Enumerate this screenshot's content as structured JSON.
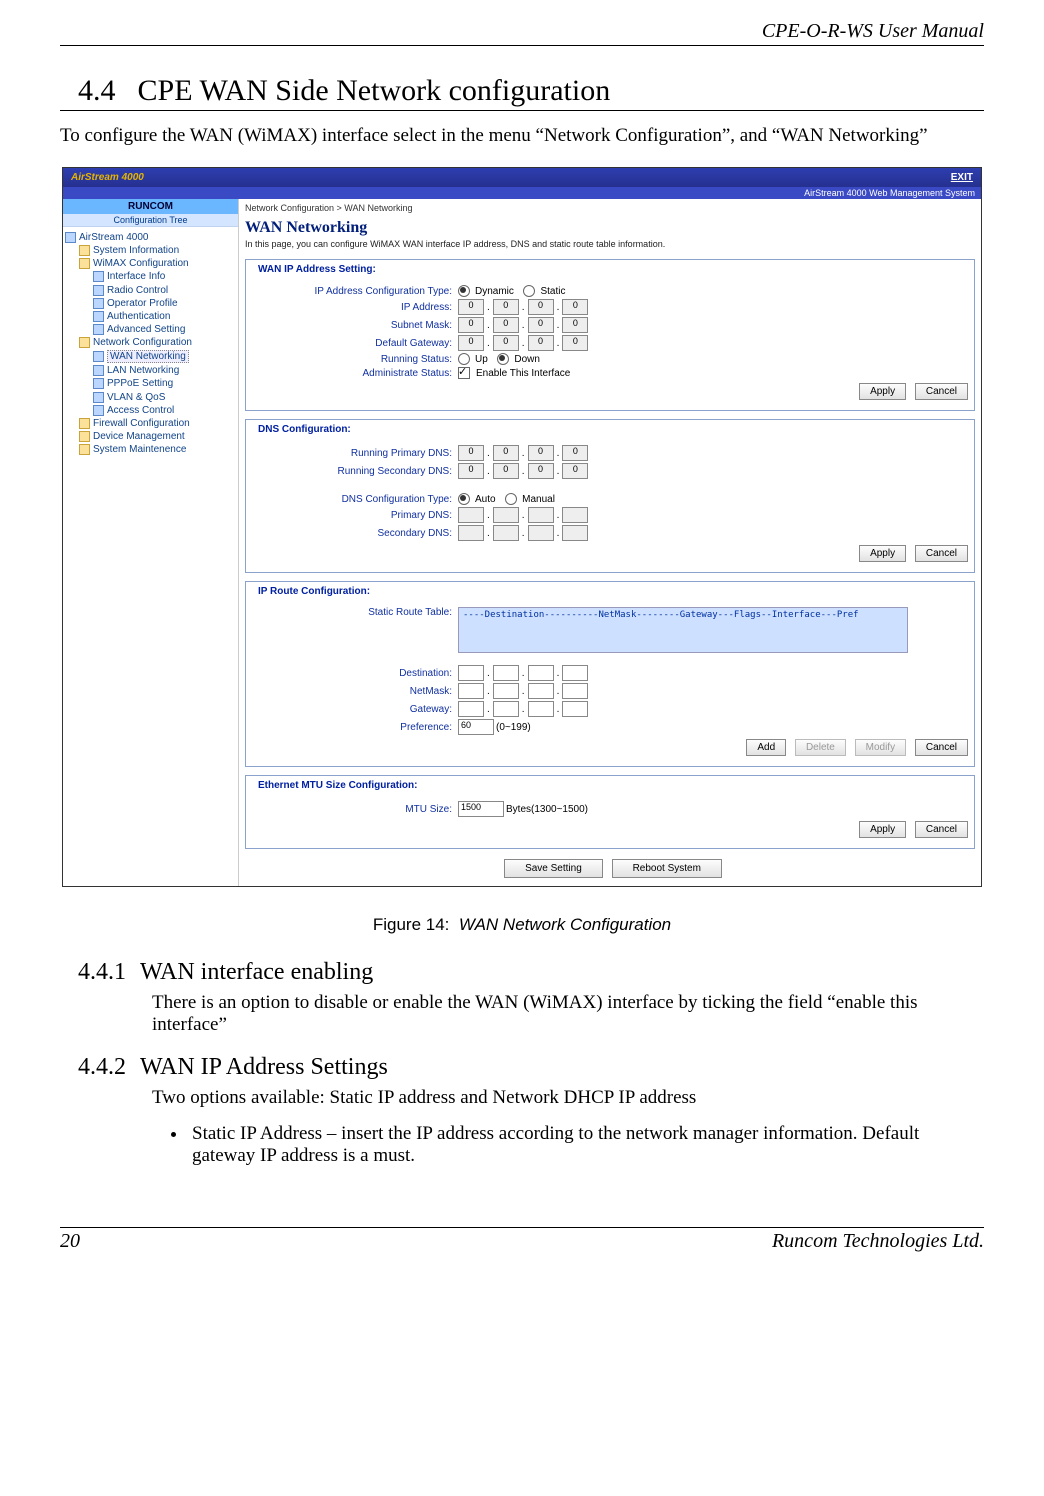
{
  "doc": {
    "header": "CPE-O-R-WS User Manual",
    "section_num": "4.4",
    "section_title": "CPE WAN Side Network configuration",
    "intro": "To configure the WAN (WiMAX) interface select in the menu “Network Configuration”, and “WAN Networking”",
    "figure_label": "Figure 14:",
    "figure_caption": "WAN Network Configuration",
    "sub1_num": "4.4.1",
    "sub1_title": "WAN interface enabling",
    "sub1_body": "There is an option to disable or enable the WAN (WiMAX) interface by ticking the field “enable this interface”",
    "sub2_num": "4.4.2",
    "sub2_title": "WAN IP Address Settings",
    "sub2_body": "Two options available: Static IP address and Network DHCP IP address",
    "sub2_bullet1": "Static IP Address – insert the IP address according to the network manager information. Default gateway IP address is a must.",
    "footer_page": "20",
    "footer_company": "Runcom Technologies Ltd."
  },
  "shot": {
    "brand": "AirStream 4000",
    "exit": "EXIT",
    "subbar": "AirStream 4000 Web Management System",
    "sidebar_company": "RUNCOM",
    "tree_header": "Configuration Tree",
    "tree": {
      "n0": "AirStream 4000",
      "n1": "System Information",
      "n2": "WiMAX Configuration",
      "n2a": "Interface Info",
      "n2b": "Radio Control",
      "n2c": "Operator Profile",
      "n2d": "Authentication",
      "n2e": "Advanced Setting",
      "n3": "Network Configuration",
      "n3a": "WAN Networking",
      "n3b": "LAN Networking",
      "n3c": "PPPoE Setting",
      "n3d": "VLAN & QoS",
      "n3e": "Access Control",
      "n4": "Firewall Configuration",
      "n5": "Device Management",
      "n6": "System Maintenence"
    },
    "crumb": "Network Configuration > WAN Networking",
    "page_title": "WAN Networking",
    "desc": "In this page, you can configure WiMAX WAN interface IP address, DNS and static route table information.",
    "panelA": {
      "title": "WAN IP Address Setting:",
      "l_type": "IP Address Configuration Type:",
      "r_dynamic": "Dynamic",
      "r_static": "Static",
      "l_ip": "IP Address:",
      "l_mask": "Subnet Mask:",
      "l_gw": "Default Gateway:",
      "l_run": "Running Status:",
      "r_up": "Up",
      "r_down": "Down",
      "l_admin": "Administrate Status:",
      "chk_enable": "Enable This Interface",
      "ip": [
        "0",
        "0",
        "0",
        "0"
      ]
    },
    "panelB": {
      "title": "DNS Configuration:",
      "l_rpdns": "Running Primary DNS:",
      "l_rsdns": "Running Secondary DNS:",
      "l_type": "DNS Configuration Type:",
      "r_auto": "Auto",
      "r_manual": "Manual",
      "l_pdns": "Primary DNS:",
      "l_sdns": "Secondary DNS:",
      "ip": [
        "0",
        "0",
        "0",
        "0"
      ]
    },
    "panelC": {
      "title": "IP Route Configuration:",
      "l_table": "Static Route Table:",
      "table_header": "----Destination----------NetMask--------Gateway---Flags--Interface---Pref",
      "l_dest": "Destination:",
      "l_mask": "NetMask:",
      "l_gw": "Gateway:",
      "l_pref": "Preference:",
      "pref_val": "60",
      "pref_hint": "(0~199)"
    },
    "panelD": {
      "title": "Ethernet MTU Size Configuration:",
      "l_mtu": "MTU Size:",
      "mtu_val": "1500",
      "mtu_hint": "Bytes(1300~1500)"
    },
    "buttons": {
      "apply": "Apply",
      "cancel": "Cancel",
      "add": "Add",
      "delete": "Delete",
      "modify": "Modify",
      "save": "Save Setting",
      "reboot": "Reboot System"
    }
  }
}
